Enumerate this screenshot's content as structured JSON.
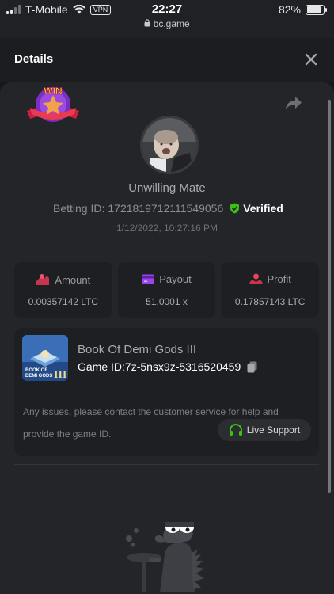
{
  "status_bar": {
    "carrier": "T-Mobile",
    "vpn": "VPN",
    "time": "22:27",
    "url": "bc.game",
    "battery": "82%",
    "battery_level": 0.82
  },
  "header": {
    "title": "Details",
    "close_icon": "close-icon"
  },
  "bet": {
    "badge": "WIN",
    "username": "Unwilling Mate",
    "betting_id_label": "Betting ID:",
    "betting_id": "1721819712111549056",
    "verified_label": "Verified",
    "datetime": "1/12/2022, 10:27:16 PM"
  },
  "stats": [
    {
      "label": "Amount",
      "value": "0.00357142 LTC",
      "icon": "amount-icon",
      "color": "#e0455e"
    },
    {
      "label": "Payout",
      "value": "51.0001 x",
      "icon": "payout-card-icon",
      "color": "#9a45e8"
    },
    {
      "label": "Profit",
      "value": "0.17857143 LTC",
      "icon": "profit-icon",
      "color": "#e0455e"
    }
  ],
  "game": {
    "name": "Book Of Demi Gods III",
    "id_label": "Game ID:",
    "id": "7z-5nsx9z-5316520459",
    "thumb_text": "BOOK OF DEMI GODS III",
    "support_text": "Any issues, please contact the customer service for help and provide the game ID.",
    "live_support_label": "Live Support"
  },
  "colors": {
    "accent_green": "#3bc117",
    "background": "#17181b",
    "panel": "#242529",
    "card": "#1e1f23"
  }
}
